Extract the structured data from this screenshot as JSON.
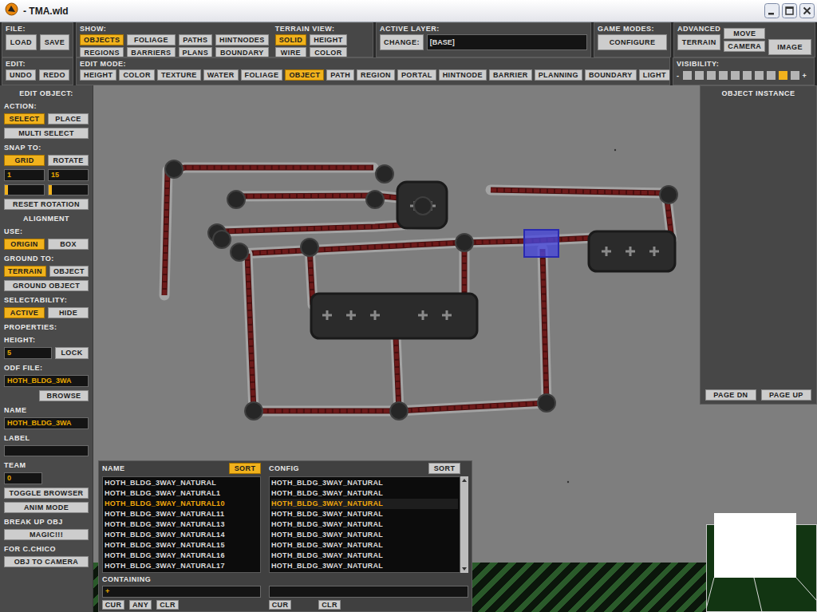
{
  "window": {
    "title": "- TMA.wld"
  },
  "toolbar": {
    "file": {
      "label": "FILE:",
      "buttons": [
        {
          "label": "LOAD"
        },
        {
          "label": "SAVE"
        }
      ]
    },
    "show": {
      "label": "SHOW:",
      "buttons": [
        {
          "label": "OBJECTS",
          "selected": true
        },
        {
          "label": "FOLIAGE",
          "selected": false
        },
        {
          "label": "PATHS",
          "selected": false
        },
        {
          "label": "HINTNODES",
          "selected": false
        },
        {
          "label": "REGIONS",
          "selected": false
        },
        {
          "label": "BARRIERS",
          "selected": false
        },
        {
          "label": "PLANS",
          "selected": false
        },
        {
          "label": "BOUNDARY",
          "selected": false
        }
      ]
    },
    "terrain_view": {
      "label": "TERRAIN VIEW:",
      "buttons": [
        {
          "label": "SOLID",
          "selected": true
        },
        {
          "label": "HEIGHT",
          "selected": false
        },
        {
          "label": "WIRE",
          "selected": false
        },
        {
          "label": "COLOR",
          "selected": false
        }
      ]
    },
    "active_layer": {
      "label": "ACTIVE LAYER:",
      "change": "CHANGE:",
      "value": "[BASE]"
    },
    "game_modes": {
      "label": "GAME MODES:",
      "button": "CONFIGURE"
    },
    "advanced": {
      "label": "ADVANCED",
      "terrain": "TERRAIN",
      "move": "MOVE",
      "camera": "CAMERA",
      "image": "IMAGE"
    },
    "edit": {
      "label": "EDIT:",
      "buttons": [
        {
          "label": "UNDO"
        },
        {
          "label": "REDO"
        }
      ]
    },
    "edit_mode": {
      "label": "EDIT MODE:",
      "buttons": [
        {
          "label": "HEIGHT",
          "selected": false
        },
        {
          "label": "COLOR",
          "selected": false
        },
        {
          "label": "TEXTURE",
          "selected": false
        },
        {
          "label": "WATER",
          "selected": false
        },
        {
          "label": "FOLIAGE",
          "selected": false
        },
        {
          "label": "OBJECT",
          "selected": true
        },
        {
          "label": "PATH",
          "selected": false
        },
        {
          "label": "REGION",
          "selected": false
        },
        {
          "label": "PORTAL",
          "selected": false
        },
        {
          "label": "HINTNODE",
          "selected": false
        },
        {
          "label": "BARRIER",
          "selected": false
        },
        {
          "label": "PLANNING",
          "selected": false
        },
        {
          "label": "BOUNDARY",
          "selected": false
        },
        {
          "label": "LIGHT",
          "selected": false
        }
      ]
    },
    "visibility": {
      "label": "VISIBILITY:",
      "minus": "-",
      "plus": "+",
      "steps": [
        {
          "selected": false
        },
        {
          "selected": false
        },
        {
          "selected": false
        },
        {
          "selected": false
        },
        {
          "selected": false
        },
        {
          "selected": false
        },
        {
          "selected": false
        },
        {
          "selected": false
        },
        {
          "selected": true
        },
        {
          "selected": false
        }
      ]
    }
  },
  "edit_object": {
    "items": [
      {
        "kind": "heading",
        "text": "EDIT OBJECT:"
      },
      {
        "kind": "label",
        "text": "ACTION:"
      },
      {
        "kind": "buttons",
        "buttons": [
          {
            "label": "SELECT",
            "selected": true
          },
          {
            "label": "PLACE",
            "selected": false
          }
        ]
      },
      {
        "kind": "buttons",
        "buttons": [
          {
            "label": "MULTI SELECT",
            "selected": false
          }
        ]
      },
      {
        "kind": "label",
        "text": "SNAP TO:"
      },
      {
        "kind": "buttons",
        "buttons": [
          {
            "label": "GRID",
            "selected": true
          },
          {
            "label": "ROTATE",
            "selected": false
          }
        ]
      },
      {
        "kind": "fields",
        "fields": [
          {
            "value": "1"
          },
          {
            "value": "15"
          }
        ]
      },
      {
        "kind": "sliders",
        "sliders": [
          {
            "level": 0.05
          },
          {
            "level": 0.05
          }
        ]
      },
      {
        "kind": "buttons",
        "buttons": [
          {
            "label": "RESET ROTATION",
            "selected": false
          }
        ]
      },
      {
        "kind": "heading",
        "text": "ALIGNMENT"
      },
      {
        "kind": "label",
        "text": "USE:"
      },
      {
        "kind": "buttons",
        "buttons": [
          {
            "label": "ORIGIN",
            "selected": true
          },
          {
            "label": "BOX",
            "selected": false
          }
        ]
      },
      {
        "kind": "label",
        "text": "GROUND TO:"
      },
      {
        "kind": "buttons",
        "buttons": [
          {
            "label": "TERRAIN",
            "selected": true
          },
          {
            "label": "OBJECT",
            "selected": false
          }
        ]
      },
      {
        "kind": "buttons",
        "buttons": [
          {
            "label": "GROUND OBJECT",
            "selected": false
          }
        ]
      },
      {
        "kind": "label",
        "text": "SELECTABILITY:"
      },
      {
        "kind": "buttons",
        "buttons": [
          {
            "label": "ACTIVE",
            "selected": true
          },
          {
            "label": "HIDE",
            "selected": false
          }
        ]
      },
      {
        "kind": "label",
        "text": "PROPERTIES:"
      },
      {
        "kind": "label",
        "text": "HEIGHT:"
      },
      {
        "kind": "field_button",
        "value": "5",
        "button": "LOCK"
      },
      {
        "kind": "label",
        "text": "ODF FILE:"
      },
      {
        "kind": "field",
        "value": "HOTH_BLDG_3WA"
      },
      {
        "kind": "buttons_right",
        "buttons": [
          {
            "label": "BROWSE",
            "selected": false
          }
        ]
      },
      {
        "kind": "label",
        "text": "NAME"
      },
      {
        "kind": "field",
        "value": "HOTH_BLDG_3WA"
      },
      {
        "kind": "label",
        "text": "LABEL"
      },
      {
        "kind": "field",
        "value": ""
      },
      {
        "kind": "label",
        "text": "TEAM"
      },
      {
        "kind": "field_short",
        "value": "0"
      },
      {
        "kind": "buttons",
        "buttons": [
          {
            "label": "TOGGLE BROWSER",
            "selected": false
          }
        ]
      },
      {
        "kind": "buttons",
        "buttons": [
          {
            "label": "ANIM MODE",
            "selected": false
          }
        ]
      },
      {
        "kind": "label",
        "text": "BREAK UP OBJ"
      },
      {
        "kind": "buttons",
        "buttons": [
          {
            "label": "MAGIC!!!",
            "selected": false
          }
        ]
      },
      {
        "kind": "label",
        "text": "FOR C.CHICO"
      },
      {
        "kind": "buttons",
        "buttons": [
          {
            "label": "OBJ TO CAMERA",
            "selected": false
          }
        ]
      }
    ]
  },
  "object_instance": {
    "title": "OBJECT INSTANCE",
    "buttons": [
      "PAGE DN",
      "PAGE UP"
    ]
  },
  "browser": {
    "name_header": "NAME",
    "name_sort": {
      "label": "SORT",
      "selected": true
    },
    "config_header": "CONFIG",
    "config_sort": {
      "label": "SORT",
      "selected": false
    },
    "rows": [
      {
        "name": "HOTH_BLDG_3WAY_NATURAL",
        "config": "HOTH_BLDG_3WAY_NATURAL",
        "selected": false
      },
      {
        "name": "HOTH_BLDG_3WAY_NATURAL1",
        "config": "HOTH_BLDG_3WAY_NATURAL",
        "selected": false
      },
      {
        "name": "HOTH_BLDG_3WAY_NATURAL10",
        "config": "HOTH_BLDG_3WAY_NATURAL",
        "selected": true
      },
      {
        "name": "HOTH_BLDG_3WAY_NATURAL11",
        "config": "HOTH_BLDG_3WAY_NATURAL",
        "selected": false
      },
      {
        "name": "HOTH_BLDG_3WAY_NATURAL13",
        "config": "HOTH_BLDG_3WAY_NATURAL",
        "selected": false
      },
      {
        "name": "HOTH_BLDG_3WAY_NATURAL14",
        "config": "HOTH_BLDG_3WAY_NATURAL",
        "selected": false
      },
      {
        "name": "HOTH_BLDG_3WAY_NATURAL15",
        "config": "HOTH_BLDG_3WAY_NATURAL",
        "selected": false
      },
      {
        "name": "HOTH_BLDG_3WAY_NATURAL16",
        "config": "HOTH_BLDG_3WAY_NATURAL",
        "selected": false
      },
      {
        "name": "HOTH_BLDG_3WAY_NATURAL17",
        "config": "HOTH_BLDG_3WAY_NATURAL",
        "selected": false
      }
    ],
    "containing": {
      "label": "CONTAINING",
      "fields": [
        "+",
        ""
      ],
      "left_buttons": [
        "CUR",
        "ANY",
        "CLR"
      ],
      "right_buttons": [
        "CUR",
        "CLR"
      ]
    }
  },
  "viewport": {
    "selection_highlight": true
  }
}
